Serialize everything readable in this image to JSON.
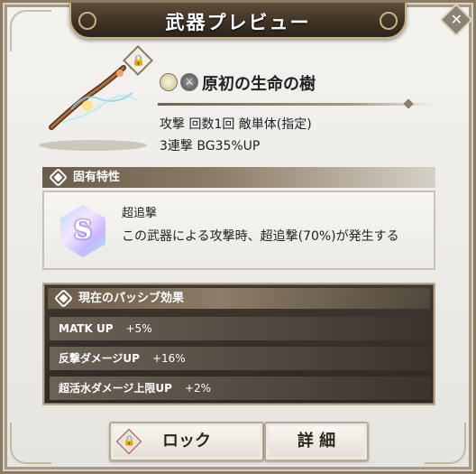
{
  "dialog": {
    "title": "武器プレビュー"
  },
  "weapon": {
    "name": "原初の生命の樹",
    "attack_line1": "攻撃  回数1回  敵単体(指定)",
    "attack_line2": "3連撃  BG35%UP",
    "element_icons": [
      "light-element-icon",
      "sword-type-icon"
    ]
  },
  "trait_section": {
    "header": "固有特性",
    "title": "超追撃",
    "description": "この武器による攻撃時、超追撃(70%)が発生する",
    "icon_letter": "S"
  },
  "passive_section": {
    "header": "現在のパッシブ効果",
    "rows": [
      {
        "name": "MATK UP",
        "value": "+5%"
      },
      {
        "name": "反撃ダメージUP",
        "value": "+16%"
      },
      {
        "name": "超活水ダメージ上限UP",
        "value": "+2%"
      }
    ]
  },
  "buttons": {
    "lock": "ロック",
    "detail": "詳 細"
  },
  "colors": {
    "panel_bg": "#ecebe7",
    "banner": "#3e3224",
    "gold_border": "#c7b27f",
    "passive_bg": "#2e2924",
    "lock_red": "#b54141"
  }
}
